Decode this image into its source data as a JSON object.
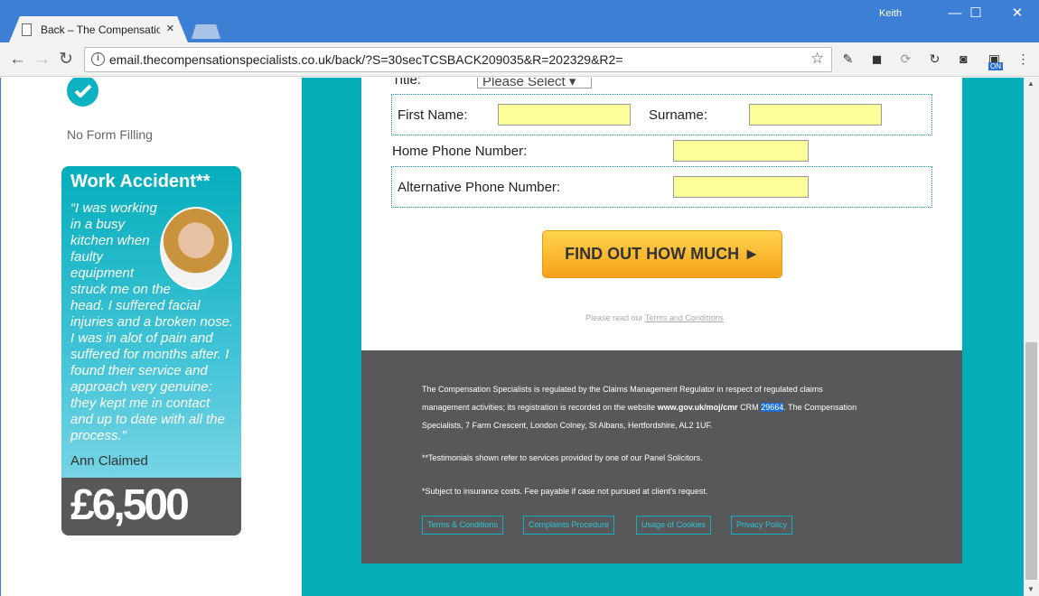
{
  "browser": {
    "tab_title": "Back – The Compensatio",
    "tab_close": "×",
    "user": "Keith",
    "url": "email.thecompensationspecialists.co.uk/back/?S=30secTCSBACK209035&R=202329&R2=",
    "info_glyph": "i",
    "star_glyph": "☆",
    "back_glyph": "←",
    "forward_glyph": "→",
    "reload_glyph": "↻",
    "min_glyph": "—",
    "max_glyph": "☐",
    "close_glyph": "✕",
    "menu_glyph": "⋮",
    "ext_on_label": "ON"
  },
  "sidebar": {
    "feature_label": "No Form Filling",
    "testimonial": {
      "title": "Work Accident**",
      "quote": "“I was working in a busy kitchen when faulty equipment struck me on the head. I suffered facial injuries and a broken nose. I was in alot of pain and suffered for months after. I found their service and approach very genuine: they kept me in contact and up to date with all the process.”",
      "name": "Ann Claimed",
      "amount": "£6,500"
    }
  },
  "form": {
    "title_label": "Title:",
    "title_select": "Please Select",
    "first_name_label": "First Name:",
    "surname_label": "Surname:",
    "home_phone_label": "Home Phone Number:",
    "alt_phone_label": "Alternative Phone Number:",
    "cta_label": "FIND OUT HOW MUCH ►",
    "terms_prefix": "Please read our",
    "terms_link": "Terms and Conditions"
  },
  "footer": {
    "reg_line1": "The Compensation Specialists is regulated by the Claims Management Regulator in respect of regulated claims",
    "reg_line2_a": "management activities; its registration is recorded on the website",
    "reg_line2_site": "www.gov.uk/moj/cmr",
    "reg_line2_crm": "CRM",
    "reg_line2_num": "29664",
    "reg_line2_b": ". The Compensation",
    "reg_line3": "Specialists, 7 Farm Crescent, London Colney, St Albans, Hertfordshire, AL2 1UF.",
    "testimonial_note": "**Testimonials shown refer to services provided by one of our Panel Solicitors.",
    "insurance_note": "*Subject to insurance costs. Fee payable if case not pursued at client's request.",
    "links": [
      "Terms & Conditions",
      "Complaints Procedure",
      "Usage of Cookies",
      "Privacy Policy"
    ]
  },
  "colors": {
    "teal": "#05adb9",
    "footer_grey": "#58585a",
    "input_yellow": "#fdfd9a",
    "cta_orange": "#f7a11a",
    "chrome_blue": "#3d7fd4"
  }
}
